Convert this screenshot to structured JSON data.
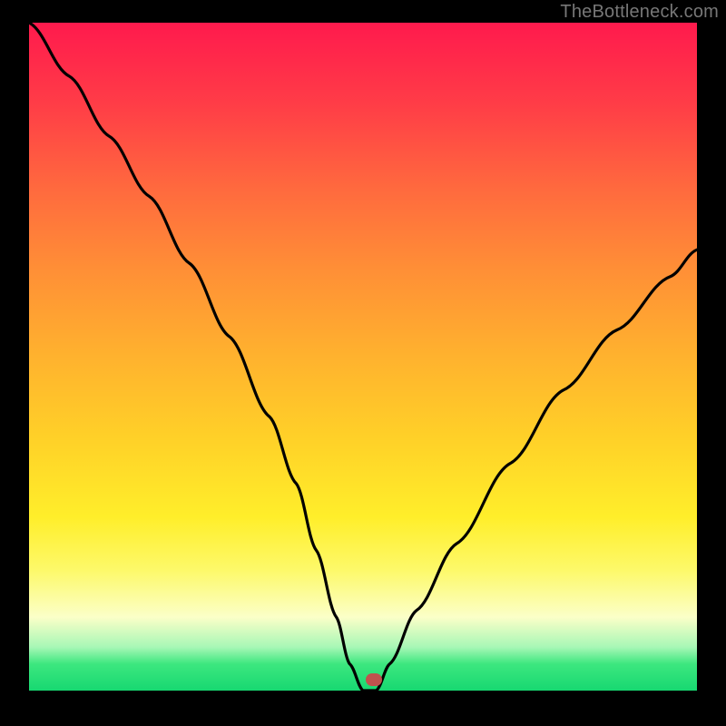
{
  "watermark": "TheBottleneck.com",
  "chart_data": {
    "type": "line",
    "title": "",
    "xlabel": "",
    "ylabel": "",
    "xlim": [
      0,
      100
    ],
    "ylim": [
      0,
      100
    ],
    "series": [
      {
        "name": "bottleneck-curve",
        "x": [
          0,
          6,
          12,
          18,
          24,
          30,
          36,
          40,
          43,
          46,
          48,
          50,
          52,
          54,
          58,
          64,
          72,
          80,
          88,
          96,
          100
        ],
        "values": [
          100,
          92,
          83,
          74,
          64,
          53,
          41,
          31,
          21,
          11,
          4,
          0,
          0,
          4,
          12,
          22,
          34,
          45,
          54,
          62,
          66
        ]
      }
    ],
    "marker": {
      "x": 51.6,
      "y": 1.6
    },
    "gradient_stops": [
      {
        "pos": 0,
        "color": "#ff1a4d"
      },
      {
        "pos": 0.5,
        "color": "#ffb22e"
      },
      {
        "pos": 0.82,
        "color": "#fdf96a"
      },
      {
        "pos": 1.0,
        "color": "#17d871"
      }
    ]
  }
}
